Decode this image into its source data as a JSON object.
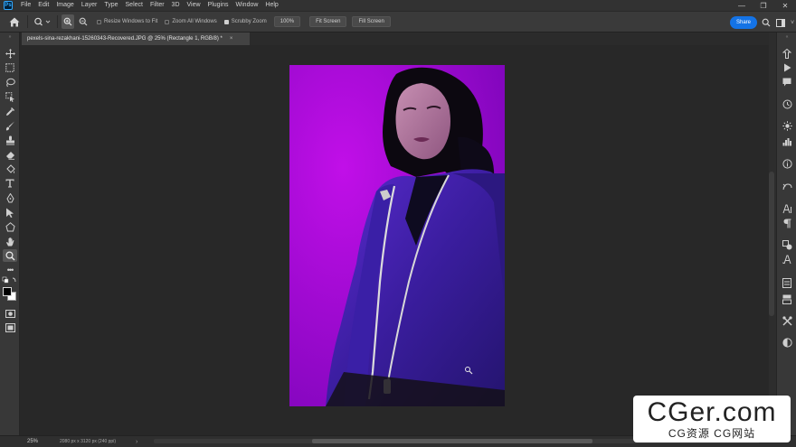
{
  "app": {
    "logo": "Ps"
  },
  "menu": [
    "File",
    "Edit",
    "Image",
    "Layer",
    "Type",
    "Select",
    "Filter",
    "3D",
    "View",
    "Plugins",
    "Window",
    "Help"
  ],
  "window_controls": {
    "minimize": "—",
    "restore": "❐",
    "close": "✕"
  },
  "options": {
    "resize_windows_label": "Resize Windows to Fit",
    "zoom_all_label": "Zoom All Windows",
    "scrubby_zoom_label": "Scrubby Zoom",
    "zoom_100_label": "100%",
    "fit_screen_label": "Fit Screen",
    "fill_screen_label": "Fill Screen",
    "share_label": "Share"
  },
  "document": {
    "tab_title": "pexels-sina-rezakhani-15260343-Recovered.JPG @ 25% (Rectangle 1, RGB/8) *",
    "tab_close": "×"
  },
  "status": {
    "zoom": "25%",
    "info": "2080 px x 3120 px (240 ppi)",
    "arrow": "›"
  },
  "watermark": {
    "main": "CGer.com",
    "sub": "CG资源 CG网站"
  },
  "colors": {
    "accent": "#1473e6",
    "photo_background": "#a10ad8",
    "jacket": "#3b1fa0"
  }
}
